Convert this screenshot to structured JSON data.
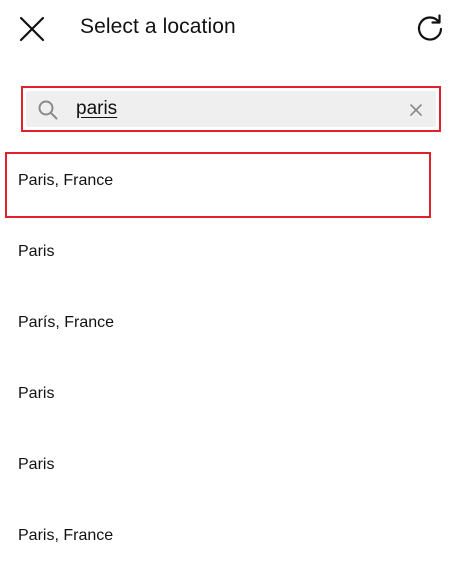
{
  "header": {
    "title": "Select a location",
    "close_icon": "close-icon",
    "refresh_icon": "refresh-icon"
  },
  "search": {
    "value": "paris",
    "search_icon": "search-icon",
    "clear_icon": "clear-icon"
  },
  "results": [
    {
      "label": "Paris, France"
    },
    {
      "label": "Paris"
    },
    {
      "label": "París, France"
    },
    {
      "label": "Paris"
    },
    {
      "label": "Paris"
    },
    {
      "label": "Paris, France"
    }
  ],
  "colors": {
    "highlight": "#e0202d",
    "search_background": "#efefef",
    "text": "#111111"
  }
}
